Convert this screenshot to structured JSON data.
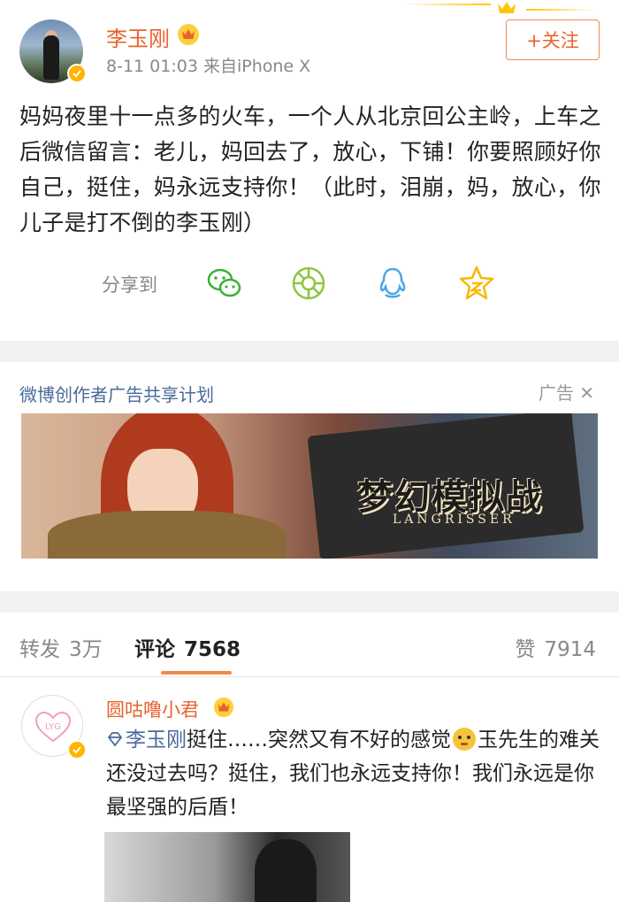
{
  "post": {
    "username": "李玉刚",
    "meta": "8-11 01:03  来自iPhone X",
    "follow_label": "+关注",
    "content": "妈妈夜里十一点多的火车，一个人从北京回公主岭，上车之后微信留言：老儿，妈回去了，放心，下铺！你要照顾好你自己，挺住，妈永远支持你！（此时，泪崩，妈，放心，你儿子是打不倒的李玉刚）"
  },
  "share": {
    "label": "分享到",
    "icons": [
      "wechat-icon",
      "moments-icon",
      "qq-icon",
      "qzone-icon"
    ],
    "colors": {
      "wechat": "#3cb034",
      "moments": "#8cc63e",
      "qq": "#4aa6e8",
      "qzone": "#f5b800"
    }
  },
  "ad": {
    "title": "微博创作者广告共享计划",
    "tag": "广告",
    "banner_title": "梦幻模拟战",
    "banner_subtitle": "LANGRISSER"
  },
  "tabs": {
    "repost": {
      "label": "转发",
      "count": "3万"
    },
    "comment": {
      "label": "评论",
      "count": "7568"
    },
    "like": {
      "label": "赞",
      "count": "7914"
    }
  },
  "comment": {
    "username": "圆咕噜小君",
    "avatar_text": "LYG",
    "mention": "李玉刚",
    "text_part1": "挺住……突然又有不好的感觉",
    "text_part2": "玉先生的难关还没过去吗？挺住，我们也永远支持你！我们永远是你最坚强的后盾！"
  },
  "colors": {
    "accent": "#e8632f",
    "link": "#4a6a9a",
    "badge": "#ffb400"
  }
}
